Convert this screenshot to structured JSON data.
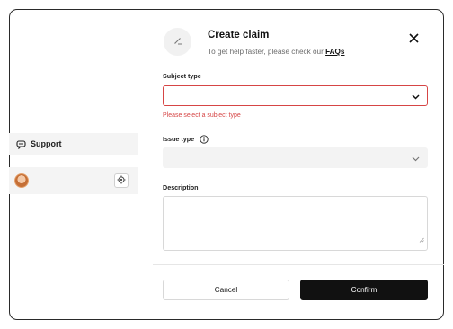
{
  "sidebar": {
    "support_label": "Support",
    "icons": {
      "support": "chat-bubble-icon",
      "settings": "gear-icon",
      "avatar": "user-avatar"
    }
  },
  "modal": {
    "title": "Create claim",
    "subtitle_prefix": "To get help faster, please check our ",
    "subtitle_link": "FAQs",
    "fields": {
      "subject_type": {
        "label": "Subject type",
        "value": "",
        "error": "Please select a subject type"
      },
      "issue_type": {
        "label": "Issue type",
        "value": ""
      },
      "description": {
        "label": "Description",
        "value": ""
      }
    },
    "buttons": {
      "cancel": "Cancel",
      "confirm": "Confirm"
    }
  },
  "colors": {
    "error": "#d64545",
    "primary": "#111111",
    "disabled_bg": "#f3f3f3"
  }
}
